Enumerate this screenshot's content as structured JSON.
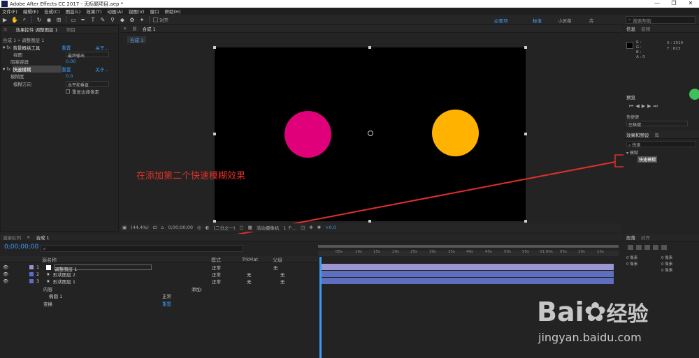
{
  "window": {
    "title": "Adobe After Effects CC 2017 - 无标题项目.aep *",
    "controls": [
      "—",
      "❐",
      "✕"
    ]
  },
  "menu": [
    "文件(F)",
    "编辑(E)",
    "合成(C)",
    "图层(L)",
    "效果(T)",
    "动画(A)",
    "视图(V)",
    "窗口",
    "帮助(H)"
  ],
  "toolbar": {
    "snap_label": "对齐",
    "workspaces": [
      "必要项",
      "标准",
      "小屏幕",
      "库"
    ],
    "search_placeholder": "搜索帮助"
  },
  "effect_controls": {
    "tabs": [
      "效果控件 调整图层 1",
      "项目"
    ],
    "breadcrumb": "合成 1 • 调整图层 1",
    "effects": [
      {
        "name": "背景概括工具",
        "reset": "重置",
        "about": "关于..."
      },
      {
        "name": "快速模糊",
        "reset": "重置",
        "about": "关于..."
      }
    ],
    "props": [
      {
        "label": "视图",
        "value": "最终输出"
      },
      {
        "label": "阻塞容器",
        "value": "0.00"
      },
      {
        "label": "模糊度",
        "value": "0.0"
      },
      {
        "label": "模糊方向",
        "value": "水平和垂直"
      },
      {
        "label": "重复边缘像素",
        "value": ""
      }
    ]
  },
  "composition": {
    "tab": "合成 1",
    "subtab": "合成 1",
    "zoom": "(44.4%)",
    "timecode": "0;00;00;00",
    "resolution": "(二分之一)",
    "camera": "活动摄像机",
    "views": "1 个...",
    "exposure": "+0.0",
    "annotation": "在添加第二个快速模糊效果",
    "colors": {
      "magenta": "#e0007a",
      "orange": "#ffb300"
    }
  },
  "timeline": {
    "tabs": [
      "渲染队列",
      "合成 1"
    ],
    "timecode": "0;00;00;00",
    "headers": {
      "layer_name": "源名称",
      "mode": "模式",
      "trkmat": "TrkMat",
      "parent": "父级"
    },
    "layers": [
      {
        "num": "1",
        "name": "调整图层 1",
        "mode": "正常",
        "trkmat": "",
        "parent": "无",
        "color": "#9b8fd6"
      },
      {
        "num": "2",
        "name": "形状图层 2",
        "mode": "正常",
        "trkmat": "无",
        "parent": "无",
        "color": "#5a6ed0"
      },
      {
        "num": "3",
        "name": "形状图层 1",
        "mode": "正常",
        "trkmat": "无",
        "parent": "无",
        "color": "#5a6ed0"
      }
    ],
    "sub_rows": [
      {
        "label": "内容",
        "value": "添加:"
      },
      {
        "label": "椭圆 1",
        "value": "正常"
      },
      {
        "label": "变换",
        "value": "重置"
      }
    ],
    "ruler": [
      "0s",
      "05s",
      "10s",
      "15s",
      "20s",
      "25s",
      "30s",
      "35s",
      "40s",
      "45s",
      "50s",
      "55s",
      "01:00s",
      "05s",
      "10s",
      "15s"
    ]
  },
  "right": {
    "info_tabs": [
      "信息",
      "音频"
    ],
    "info_values": {
      "r": "R :",
      "g": "G :",
      "b": "B :",
      "a": "A : 0",
      "x": "X : 2510",
      "y": "Y : 623"
    },
    "preview_tab": "预览",
    "shortcut_label": "快捷键",
    "shortcut_value": "空格键",
    "effects_tabs": [
      "效果和预设",
      "库"
    ],
    "effects_search": "快速",
    "effects_folder": "▾ 模糊",
    "effects_item": "快速模糊",
    "para_tabs": [
      "段落",
      "对齐"
    ],
    "para_values": [
      "0 像素",
      "0 像素",
      "0 像素",
      "0 像素",
      "0 像素"
    ]
  },
  "watermark": {
    "brand": "Bai",
    "suffix": "经验",
    "url": "jingyan.baidu.com"
  }
}
